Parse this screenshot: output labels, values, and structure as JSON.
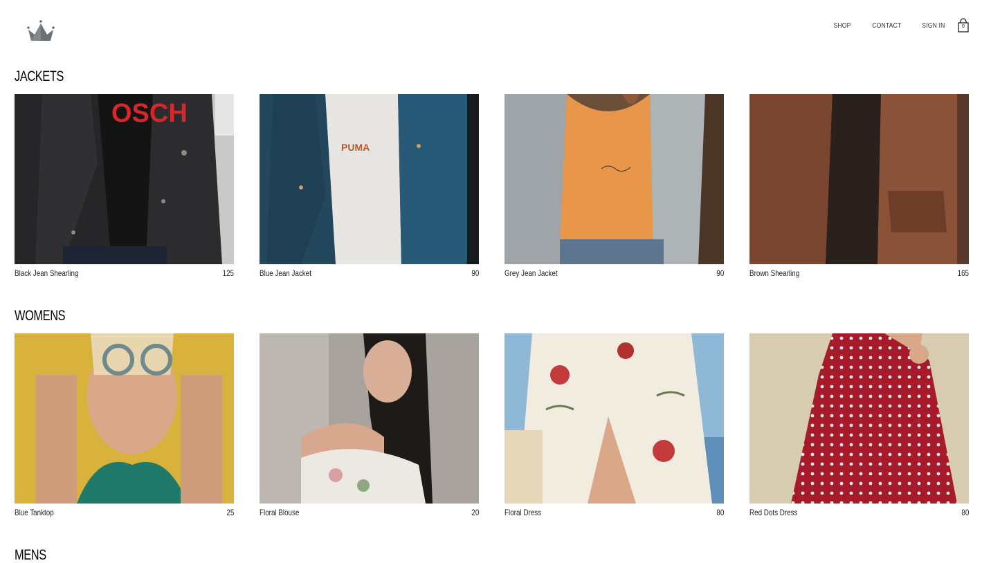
{
  "nav": {
    "shop": "SHOP",
    "contact": "CONTACT",
    "sign_in": "SIGN IN",
    "cart_count": "0",
    "logo_icon": "crown-icon",
    "cart_icon": "shopping-bag-icon"
  },
  "sections": [
    {
      "title": "JACKETS",
      "items": [
        {
          "name": "Black Jean Shearling",
          "price": "125",
          "print": "OSCH"
        },
        {
          "name": "Blue Jean Jacket",
          "price": "90",
          "print": "PUMA"
        },
        {
          "name": "Grey Jean Jacket",
          "price": "90"
        },
        {
          "name": "Brown Shearling",
          "price": "165"
        }
      ]
    },
    {
      "title": "WOMENS",
      "items": [
        {
          "name": "Blue Tanktop",
          "price": "25"
        },
        {
          "name": "Floral Blouse",
          "price": "20"
        },
        {
          "name": "Floral Dress",
          "price": "80"
        },
        {
          "name": "Red Dots Dress",
          "price": "80"
        }
      ]
    },
    {
      "title": "MENS",
      "items": []
    }
  ],
  "colors": {
    "background": "#ffffff",
    "text": "#111111",
    "logo_gray": "#6b7075"
  }
}
